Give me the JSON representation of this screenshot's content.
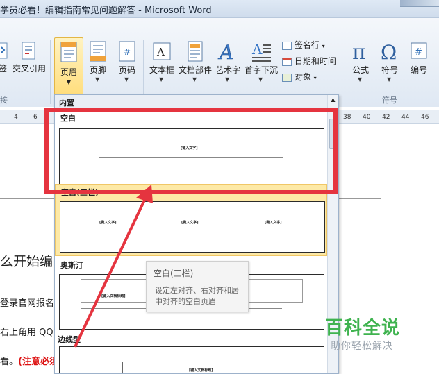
{
  "window": {
    "title": "学员必看！编辑指南常见问题解答 - Microsoft Word"
  },
  "ribbon": {
    "partial_left": {
      "label1": "签",
      "label2": "交叉引用",
      "group": "接"
    },
    "header_footer": {
      "header": "页眉",
      "footer": "页脚",
      "page_number": "页码"
    },
    "text": {
      "textbox": "文本框",
      "quick_parts": "文档部件",
      "wordart": "艺术字",
      "dropcap": "首字下沉",
      "signature_line": "签名行",
      "date_time": "日期和时间",
      "object": "对象"
    },
    "symbols": {
      "equation": "公式",
      "symbol": "符号",
      "number": "编号",
      "group": "符号"
    }
  },
  "ruler": {
    "left_ticks": [
      "4",
      "6"
    ],
    "right_ticks": [
      "38",
      "40",
      "42",
      "44",
      "46"
    ]
  },
  "document": {
    "fragment_1": "么开始编",
    "fragment_2": "登录官网报名",
    "fragment_3": "右上角用 QQ",
    "fragment_4_black": "看。",
    "fragment_4_red": "(注意必须"
  },
  "gallery": {
    "section_label": "内置",
    "items": [
      {
        "name": "空白",
        "placeholders": [
          "[键入文字]"
        ]
      },
      {
        "name": "空白(三栏)",
        "placeholders": [
          "[键入文字]",
          "[键入文字]",
          "[键入文字]"
        ]
      },
      {
        "name": "奥斯汀",
        "placeholders": [
          "[键入文档标题]"
        ]
      },
      {
        "name": "边线型",
        "placeholders": [
          "[键入文档标题]"
        ]
      }
    ]
  },
  "tooltip": {
    "title": "空白(三栏)",
    "description": "设定左对齐、右对齐和居中对齐的空白页眉"
  },
  "watermark": {
    "brand": "百科全说",
    "slogan": "助你轻松解决"
  },
  "colors": {
    "highlight_red": "#e5343f",
    "selected_yellow": "#ffd86b",
    "watermark_green": "#3fb34f"
  }
}
